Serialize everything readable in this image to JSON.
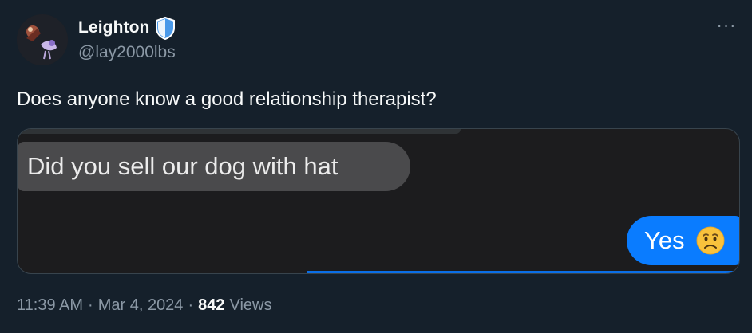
{
  "author": {
    "display_name": "Leighton",
    "handle": "@lay2000lbs",
    "verified": true,
    "verified_badge_color": "#4a99e9",
    "avatar_icon": "avatar-icon"
  },
  "more_label": "···",
  "tweet": {
    "text": "Does anyone know a good relationship therapist?"
  },
  "media": {
    "received_message": "Did you sell our dog with hat",
    "sent_message": "Yes",
    "sent_emoji_icon": "worried-face-emoji",
    "received_bubble_color": "#4a4a4c",
    "sent_bubble_color": "#0a7cff"
  },
  "meta": {
    "time": "11:39 AM",
    "dot1": "·",
    "date": "Mar 4, 2024",
    "dot2": "·",
    "views_count": "842",
    "views_label": "Views"
  }
}
